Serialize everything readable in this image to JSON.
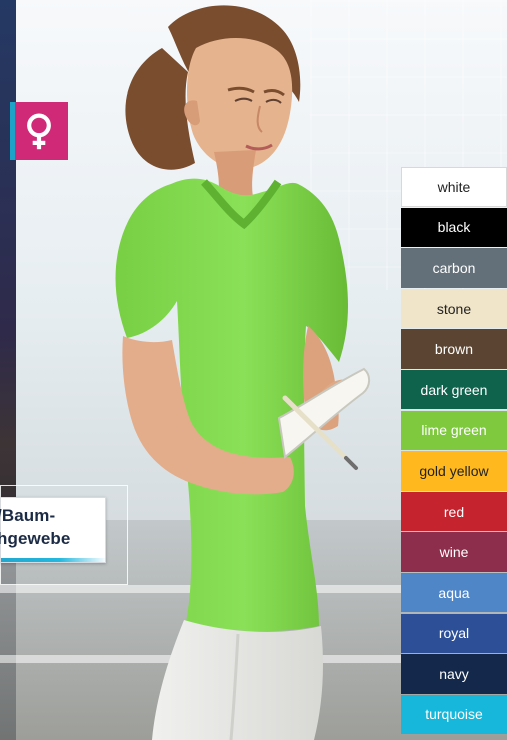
{
  "fabric": {
    "line1": "/Baum-",
    "line2": "hgewebe"
  },
  "gender_icon": "female-symbol-icon",
  "swatches": [
    {
      "label": "white",
      "color": "#ffffff",
      "text": "#222222"
    },
    {
      "label": "black",
      "color": "#000000",
      "text": "#ffffff"
    },
    {
      "label": "carbon",
      "color": "#647079",
      "text": "#ffffff"
    },
    {
      "label": "stone",
      "color": "#f0e5c8",
      "text": "#222222"
    },
    {
      "label": "brown",
      "color": "#5b4532",
      "text": "#ffffff"
    },
    {
      "label": "dark green",
      "color": "#0f624c",
      "text": "#ffffff"
    },
    {
      "label": "lime green",
      "color": "#7fc93e",
      "text": "#ffffff"
    },
    {
      "label": "gold yellow",
      "color": "#ffb91f",
      "text": "#222222"
    },
    {
      "label": "red",
      "color": "#c5232e",
      "text": "#ffffff"
    },
    {
      "label": "wine",
      "color": "#8d2f4c",
      "text": "#ffffff"
    },
    {
      "label": "aqua",
      "color": "#4f86c8",
      "text": "#ffffff"
    },
    {
      "label": "royal",
      "color": "#2d4f97",
      "text": "#ffffff"
    },
    {
      "label": "navy",
      "color": "#13284a",
      "text": "#ffffff"
    },
    {
      "label": "turquoise",
      "color": "#16b7da",
      "text": "#ffffff"
    }
  ],
  "colors": {
    "tile": "#d02978",
    "tile_accent": "#1fa2c8",
    "shirt": "#7fd649",
    "skin": "#e8b38f",
    "hair": "#7a4d2f"
  }
}
